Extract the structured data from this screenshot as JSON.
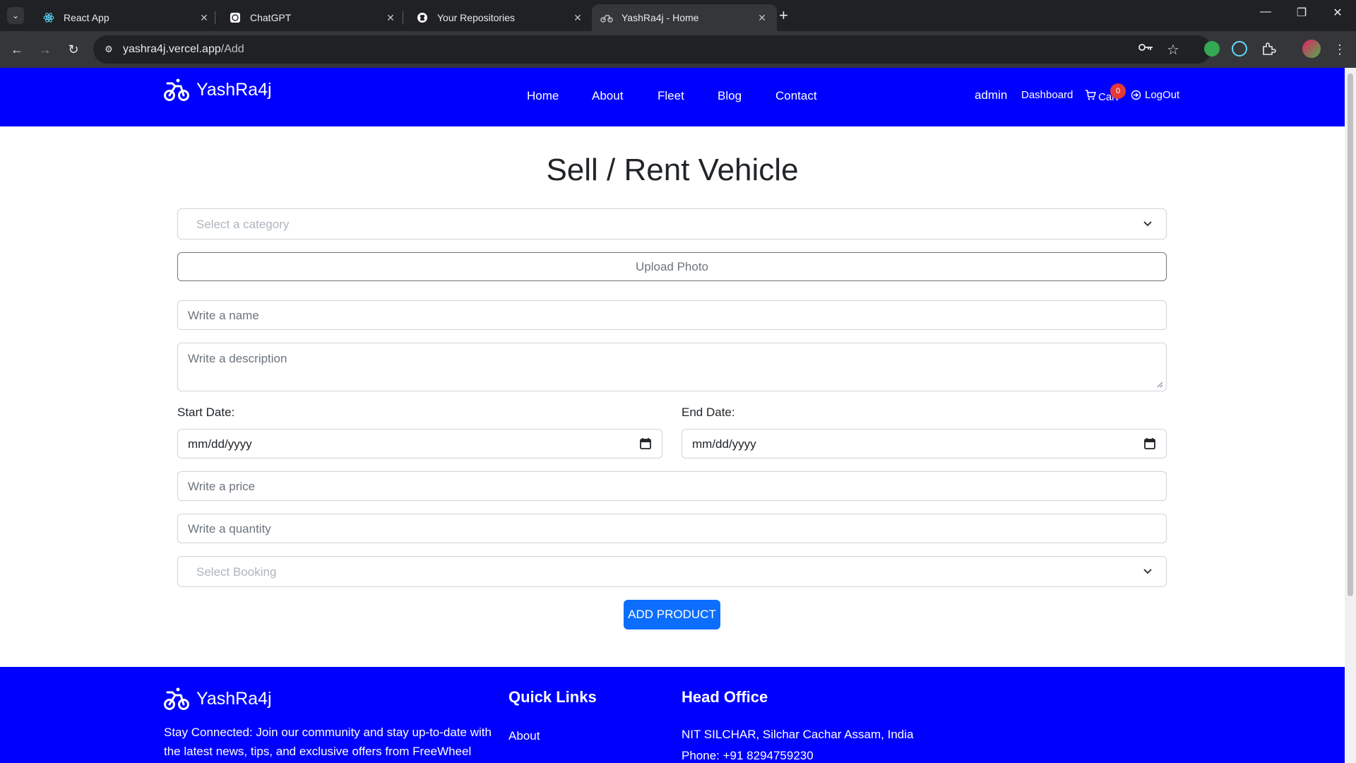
{
  "browser": {
    "tabs": [
      {
        "title": "React App",
        "icon": "react-icon"
      },
      {
        "title": "ChatGPT",
        "icon": "chatgpt-icon"
      },
      {
        "title": "Your Repositories",
        "icon": "github-icon"
      },
      {
        "title": "YashRa4j - Home",
        "icon": "bike-icon",
        "active": true
      }
    ],
    "url_host": "yashra4j.vercel.app",
    "url_path": "/Add"
  },
  "site": {
    "brand": "YashRa4j",
    "nav_links": [
      "Home",
      "About",
      "Fleet",
      "Blog",
      "Contact"
    ],
    "nav_right": {
      "user": "admin",
      "dashboard": "Dashboard",
      "cart": "Cart",
      "cart_count": "0",
      "logout": "LogOut"
    },
    "colors": {
      "primary": "#0000ff",
      "button": "#0d6efd",
      "badge": "#e53935"
    }
  },
  "form": {
    "title": "Sell / Rent Vehicle",
    "category_placeholder": "Select a category",
    "upload_label": "Upload Photo",
    "name_placeholder": "Write a name",
    "description_placeholder": "Write a description",
    "start_date_label": "Start Date:",
    "end_date_label": "End Date:",
    "date_placeholder": "mm/dd/yyyy",
    "price_placeholder": "Write a price",
    "quantity_placeholder": "Write a quantity",
    "booking_placeholder": "Select Booking",
    "submit_label": "ADD PRODUCT"
  },
  "footer": {
    "brand": "YashRa4j",
    "tagline": "Stay Connected: Join our community and stay up-to-date with the latest news, tips, and exclusive offers from FreeWheel",
    "quick_links_heading": "Quick Links",
    "quick_links": [
      "About"
    ],
    "head_office_heading": "Head Office",
    "address": "NIT SILCHAR, Silchar Cachar Assam, India",
    "phone": "Phone: +91 8294759230"
  }
}
